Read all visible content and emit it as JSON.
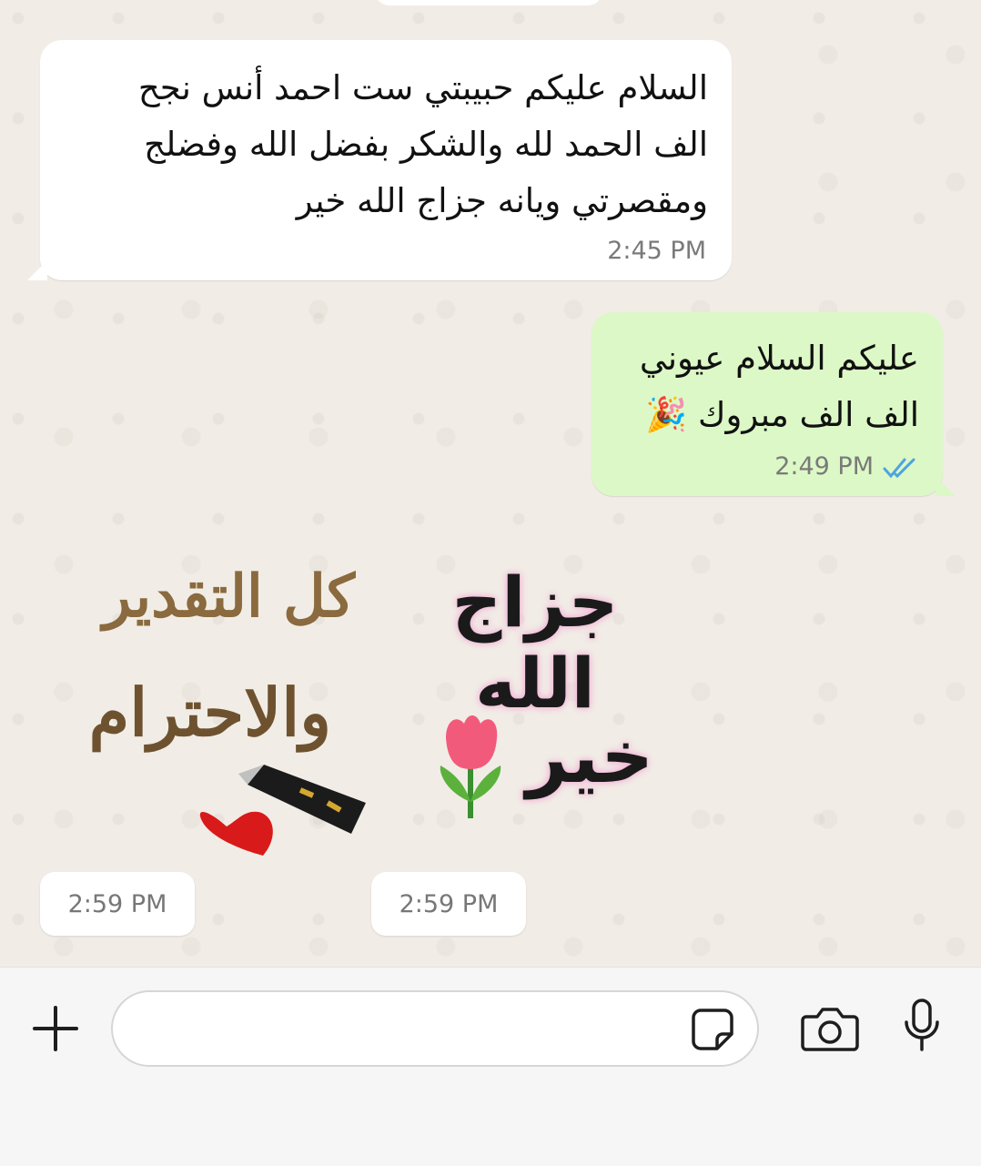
{
  "messages": [
    {
      "direction": "incoming",
      "lines": [
        "السلام عليكم حبيبتي ست احمد أنس نجح",
        "الف الحمد لله والشكر بفضل الله وفضلج",
        "ومقصرتي ويانه جزاج الله خير"
      ],
      "time": "2:45 PM"
    },
    {
      "direction": "outgoing",
      "lines": [
        "عليكم السلام عيوني",
        "الف الف مبروك 🎉"
      ],
      "time": "2:49 PM",
      "status": "read"
    }
  ],
  "stickers": [
    {
      "lines": [
        "كل التقدير",
        "والاحترام"
      ],
      "time": "2:59 PM"
    },
    {
      "lines": [
        "جزاج الله",
        "خير"
      ],
      "time": "2:59 PM"
    }
  ],
  "input_bar": {
    "placeholder": ""
  },
  "icons": {
    "add": "plus-icon",
    "sticker": "sticker-icon",
    "camera": "camera-icon",
    "mic": "microphone-icon"
  },
  "colors": {
    "outgoing_bubble": "#dcf8c6",
    "incoming_bubble": "#ffffff",
    "read_ticks": "#4fa3e0",
    "wallpaper": "#f1ede6"
  }
}
